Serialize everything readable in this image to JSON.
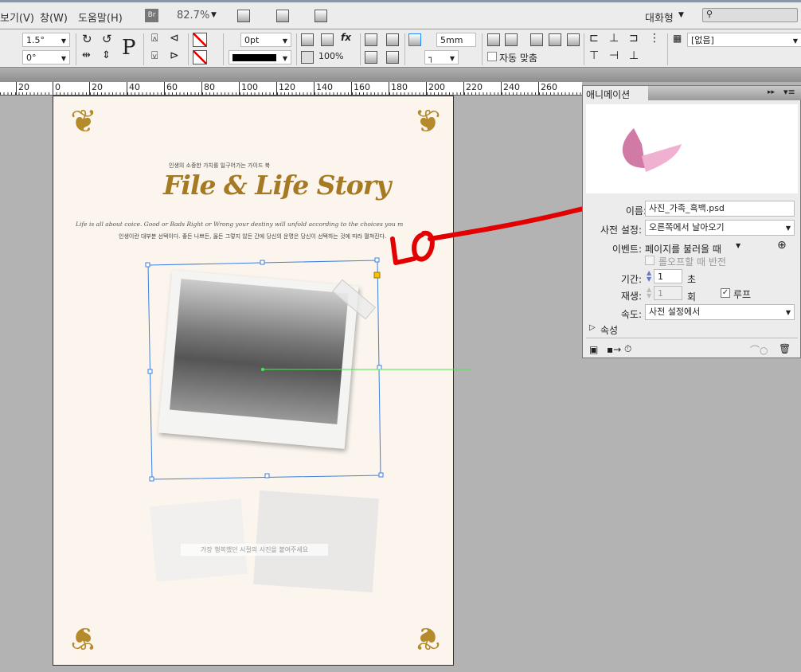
{
  "menubar": {
    "items": [
      "보기(V)",
      "창(W)",
      "도움말(H)"
    ],
    "bridge_label": "Br",
    "zoom": "82.7%",
    "workspace": "대화형",
    "search_placeholder": ""
  },
  "control": {
    "shear_angle": "1.5°",
    "rotate_angle": "0°",
    "stroke_weight": "0pt",
    "opacity": "100%",
    "gap": "5mm",
    "auto_fit_label": "자동 맞춤",
    "object_style": "[없음]"
  },
  "ruler": {
    "ticks": [
      "20",
      "0",
      "20",
      "40",
      "60",
      "80",
      "100",
      "120",
      "140",
      "160",
      "180",
      "200",
      "220",
      "240",
      "260"
    ]
  },
  "document": {
    "subtitle": "인생의 소중한 가치를 일구어가는 가이드 북",
    "title": "File & Life Story",
    "quote_en": "Life is all about coice. Good or Bads Right or Wrong your destiny will unfold according to the choices you m",
    "quote_ko": "인생이란 대부분 선택이다. 좋든 나쁘든, 옳든 그렇지 않든 간에 당신의 운명은 당신이 선택하는 것에 따라 펼쳐진다.",
    "caption": "가장 행복했던 시절의 사진을 붙여주세요"
  },
  "panel": {
    "tab": "애니메이션",
    "name_label": "이름:",
    "name_value": "사진_가족_흑백.psd",
    "preset_label": "사전 설정:",
    "preset_value": "오른쪽에서 날아오기",
    "event_label": "이벤트:",
    "event_value": "페이지를 불러올 때",
    "rollover_label": "롤오프할 때 반전",
    "duration_label": "기간:",
    "duration_value": "1",
    "duration_unit": "초",
    "play_label": "재생:",
    "play_value": "1",
    "play_unit": "회",
    "loop_label": "루프",
    "loop_checked": true,
    "speed_label": "속도:",
    "speed_value": "사전 설정에서",
    "properties_label": "속성"
  },
  "annotation": {
    "text": "LO"
  },
  "colors": {
    "annotation": "#e30000",
    "selection": "#3d7fe0",
    "motion_path": "#44ee44"
  }
}
